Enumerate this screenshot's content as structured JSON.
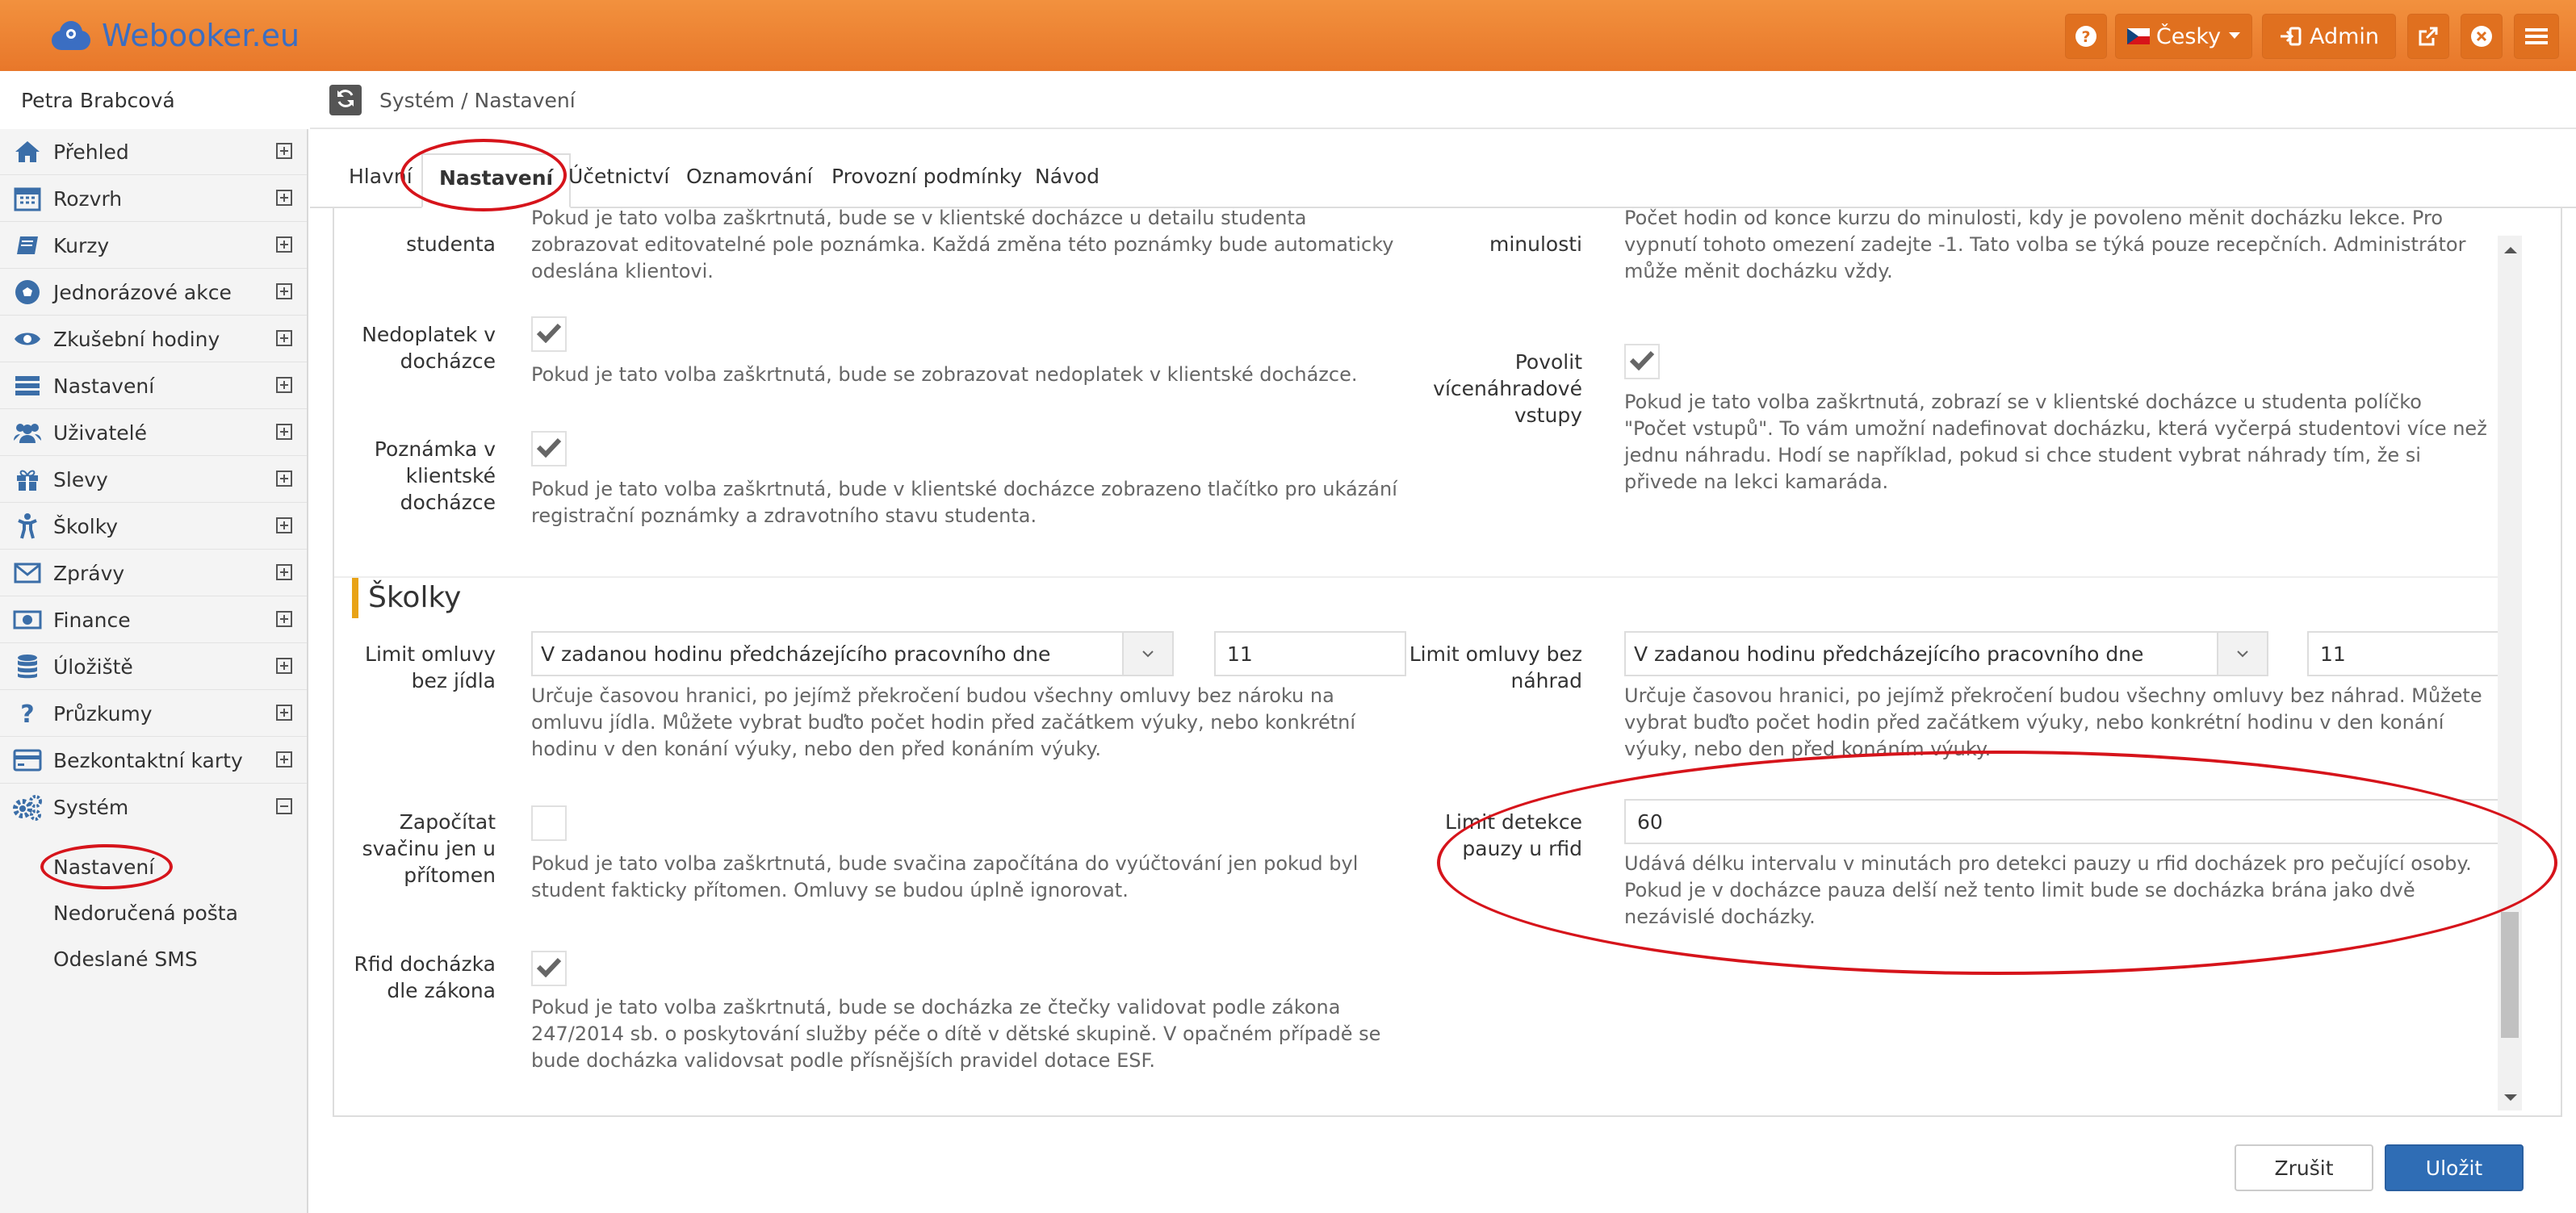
{
  "app": {
    "brand": "Webooker.eu",
    "language_label": "Česky",
    "admin_label": "Admin",
    "accent_color": "#ef8532",
    "logo_color": "#3b6ec2"
  },
  "sidebar": {
    "user_name": "Petra Brabcová",
    "items": [
      {
        "label": "Přehled",
        "icon": "home-icon"
      },
      {
        "label": "Rozvrh",
        "icon": "calendar-icon"
      },
      {
        "label": "Kurzy",
        "icon": "book-icon"
      },
      {
        "label": "Jednorázové akce",
        "icon": "soccer-ball-icon"
      },
      {
        "label": "Zkušební hodiny",
        "icon": "eye-icon"
      },
      {
        "label": "Nastavení",
        "icon": "list-icon"
      },
      {
        "label": "Uživatelé",
        "icon": "users-icon"
      },
      {
        "label": "Slevy",
        "icon": "gift-icon"
      },
      {
        "label": "Školky",
        "icon": "child-icon"
      },
      {
        "label": "Zprávy",
        "icon": "envelope-icon"
      },
      {
        "label": "Finance",
        "icon": "money-icon"
      },
      {
        "label": "Úložiště",
        "icon": "database-icon"
      },
      {
        "label": "Průzkumy",
        "icon": "question-icon"
      },
      {
        "label": "Bezkontaktní karty",
        "icon": "credit-card-icon"
      },
      {
        "label": "Systém",
        "icon": "gears-icon"
      }
    ],
    "subitems": [
      "Nastavení",
      "Nedoručená pošta",
      "Odeslané SMS"
    ]
  },
  "header": {
    "breadcrumb": "Systém / Nastavení"
  },
  "tabs": [
    "Hlavní",
    "Nastavení",
    "Účetnictví",
    "Oznamování",
    "Provozní podmínky",
    "Návod"
  ],
  "form": {
    "top_left_label": "studenta",
    "top_left_help": "Pokud je tato volba zaškrtnutá, bude se v klientské docházce u detailu studenta zobrazovat editovatelné pole poznámka. Každá změna této poznámky bude automaticky odeslána klientovi.",
    "top_right_label": "minulosti",
    "top_right_help": "Počet hodin od konce kurzu do minulosti, kdy je povoleno měnit docházku lekce. Pro vypnutí tohoto omezení zadejte -1. Tato volba se týká pouze recepčních. Administrátor může měnit docházku vždy.",
    "nedoplatek_label": "Nedoplatek v docházce",
    "nedoplatek_help": "Pokud je tato volba zaškrtnutá, bude se zobrazovat nedoplatek v klientské docházce.",
    "poznamka_label": "Poznámka v klientské docházce",
    "poznamka_help": "Pokud je tato volba zaškrtnutá, bude v klientské docházce zobrazeno tlačítko pro ukázání registrační poznámky a zdravotního stavu studenta.",
    "vstupy_label": "Povolit vícenáhradové vstupy",
    "vstupy_help": "Pokud je tato volba zaškrtnutá, zobrazí se v klientské docházce u studenta políčko \"Počet vstupů\". To vám umožní nadefinovat docházku, která vyčerpá studentovi více než jednu náhradu. Hodí se například, pokud si chce student vybrat náhrady tím, že si přivede na lekci kamaráda.",
    "section_title": "Školky",
    "omluvy_jidlo_label": "Limit omluvy bez jídla",
    "omluvy_jidlo_select": "V zadanou hodinu předcházejícího pracovního dne",
    "omluvy_jidlo_value": "11",
    "omluvy_jidlo_help": "Určuje časovou hranici, po jejímž překročení budou všechny omluvy bez nároku na omluvu jídla. Můžete vybrat buďto počet hodin před začátkem výuky, nebo konkrétní hodinu v den konání výuky, nebo den před konáním výuky.",
    "omluvy_nahrad_label": "Limit omluvy bez náhrad",
    "omluvy_nahrad_select": "V zadanou hodinu předcházejícího pracovního dne",
    "omluvy_nahrad_value": "11",
    "omluvy_nahrad_help": "Určuje časovou hranici, po jejímž překročení budou všechny omluvy bez náhrad. Můžete vybrat buďto počet hodin před začátkem výuky, nebo konkrétní hodinu v den konání výuky, nebo den před konáním výuky.",
    "svacina_label": "Započítat svačinu jen u přítomen",
    "svacina_help": "Pokud je tato volba zaškrtnutá, bude svačina započítána do vyúčtování jen pokud byl student fakticky přítomen. Omluvy se budou úplně ignorovat.",
    "rfid_limit_label": "Limit detekce pauzy u rfid",
    "rfid_limit_value": "60",
    "rfid_limit_help": "Udává délku intervalu v minutách pro detekci pauzy u rfid docházek pro pečující osoby. Pokud je v docházce pauza delší než tento limit bude se docházka brána jako dvě nezávislé docházky.",
    "rfid_zakon_label": "Rfid docházka dle zákona",
    "rfid_zakon_help": "Pokud je tato volba zaškrtnutá, bude se docházka ze čtečky validovat podle zákona 247/2014 sb. o poskytování služby péče o dítě v dětské skupině. V opačném případě se bude docházka validovsat podle přísnějších pravidel dotace ESF."
  },
  "footer": {
    "cancel_label": "Zrušit",
    "save_label": "Uložit"
  }
}
